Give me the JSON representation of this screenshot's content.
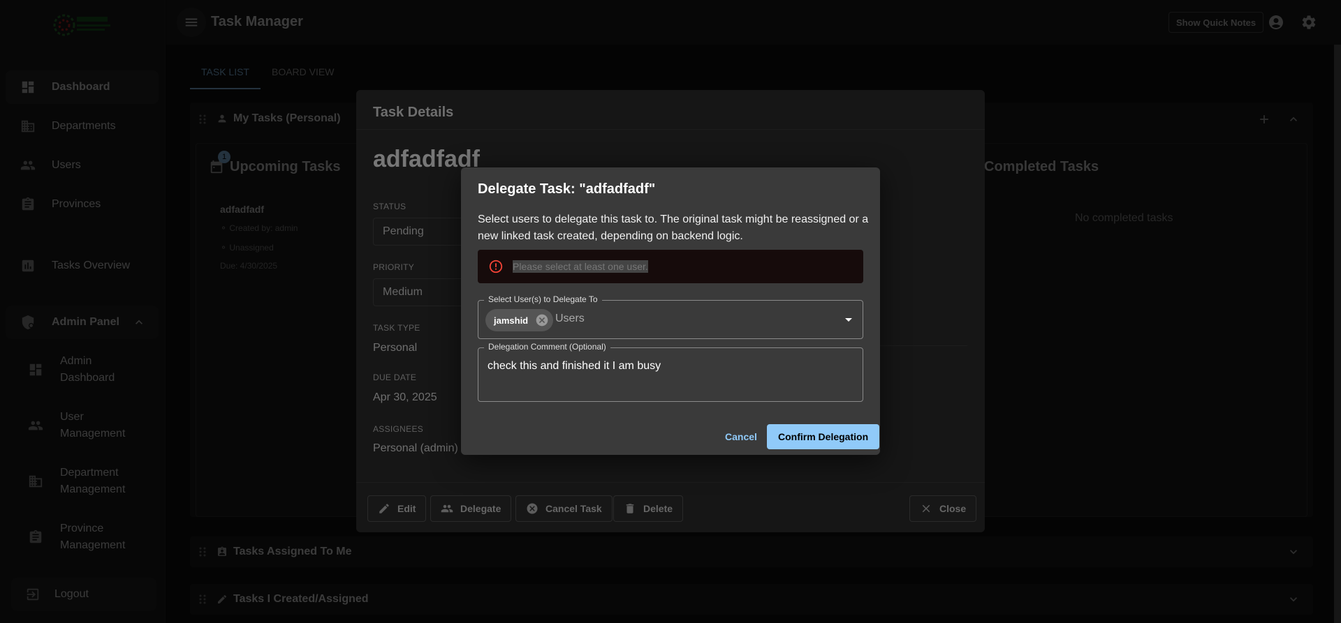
{
  "app": {
    "title": "Task Manager",
    "quick_notes_label": "Show Quick Notes"
  },
  "sidebar": {
    "items": [
      {
        "label": "Dashboard"
      },
      {
        "label": "Departments"
      },
      {
        "label": "Users"
      },
      {
        "label": "Provinces"
      },
      {
        "label": "Tasks Overview"
      }
    ],
    "admin_panel": {
      "label": "Admin Panel"
    },
    "admin_items": [
      {
        "label": "Admin Dashboard"
      },
      {
        "label": "User Management"
      },
      {
        "label": "Department Management"
      },
      {
        "label": "Province Management"
      }
    ],
    "logout_label": "Logout"
  },
  "tabs": [
    {
      "label": "TASK LIST"
    },
    {
      "label": "BOARD VIEW"
    }
  ],
  "sections": {
    "my_tasks": "My Tasks (Personal)",
    "assigned_to_me": "Tasks Assigned To Me",
    "created_assigned": "Tasks I Created/Assigned"
  },
  "board": {
    "upcoming_title": "Upcoming Tasks",
    "upcoming_badge": "1",
    "completed_title": "Completed Tasks",
    "no_completed": "No completed tasks",
    "card": {
      "title": "adfadfadf",
      "created_by": "Created by: admin",
      "assignee": "Unassigned",
      "due": "Due: 4/30/2025"
    }
  },
  "task_details": {
    "header": "Task Details",
    "task_title": "adfadfadf",
    "status_label": "STATUS",
    "status_value": "Pending",
    "priority_label": "PRIORITY",
    "priority_value": "Medium",
    "type_label": "TASK TYPE",
    "type_value": "Personal",
    "due_label": "DUE DATE",
    "due_value": "Apr 30, 2025",
    "assignees_label": "ASSIGNEES",
    "assignees_value": "Personal (admin)",
    "actions": {
      "edit": "Edit",
      "delegate": "Delegate",
      "cancel_task": "Cancel Task",
      "delete": "Delete",
      "close": "Close"
    }
  },
  "delegate_dialog": {
    "title": "Delegate Task: \"adfadfadf\"",
    "description": "Select users to delegate this task to. The original task might be reassigned or a new linked task created, depending on backend logic.",
    "error": "Please select at least one user.",
    "users_field_label": "Select User(s) to Delegate To",
    "selected_chip": "jamshid",
    "users_placeholder": "Users",
    "comment_label": "Delegation Comment (Optional)",
    "comment_value": "check this and finished it I am busy",
    "cancel_label": "Cancel",
    "confirm_label": "Confirm Delegation"
  },
  "colors": {
    "accent": "#90caf9",
    "error": "#f44336",
    "surface": "#1e1e1e",
    "dialog": "#3a3a3a"
  }
}
